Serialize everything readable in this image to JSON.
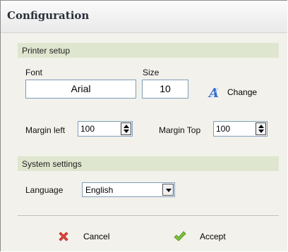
{
  "window": {
    "title": "Configuration"
  },
  "printer_setup": {
    "header": "Printer setup",
    "font_label": "Font",
    "font_value": "Arial",
    "size_label": "Size",
    "size_value": "10",
    "change_label": "Change",
    "margin_left_label": "Margin left",
    "margin_left_value": "100",
    "margin_top_label": "Margin Top",
    "margin_top_value": "100"
  },
  "system_settings": {
    "header": "System settings",
    "language_label": "Language",
    "language_value": "English"
  },
  "actions": {
    "cancel_label": "Cancel",
    "accept_label": "Accept"
  },
  "icons": {
    "change": "font-change-icon",
    "cancel": "red-x-icon",
    "accept": "green-checkmark-icon"
  },
  "colors": {
    "section_header_bg": "#dfe6cf",
    "window_bg": "#f2f1eb",
    "input_border": "#7f9db9"
  }
}
